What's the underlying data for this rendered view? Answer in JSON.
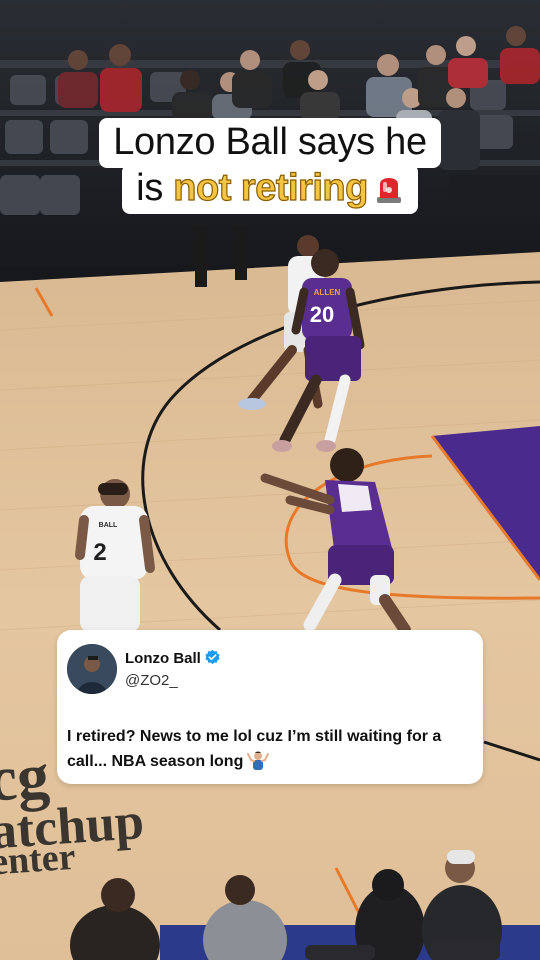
{
  "headline": {
    "line1": "Lonzo Ball says he",
    "line2_prefix": "is",
    "line2_highlight": "not retiring",
    "emoji": "police-light-icon"
  },
  "tweet": {
    "author": "Lonzo Ball",
    "handle": "@ZO2_",
    "text": "I retired? News to me lol cuz I’m still waiting for a call... NBA season long",
    "trailing_emoji": "man-shrugging-icon"
  },
  "court": {
    "floor_text_1": "cg",
    "floor_text_2": "atchup",
    "floor_text_3": "enter",
    "jersey_player_1": "20",
    "jersey_name_1": "ALLEN",
    "jersey_player_2": "2",
    "jersey_name_2": "BALL"
  },
  "colors": {
    "highlight": "#f4c542",
    "paint": "#4a2a8c",
    "court_wood": "#e2c39c",
    "suns_purple": "#5a2d91"
  }
}
